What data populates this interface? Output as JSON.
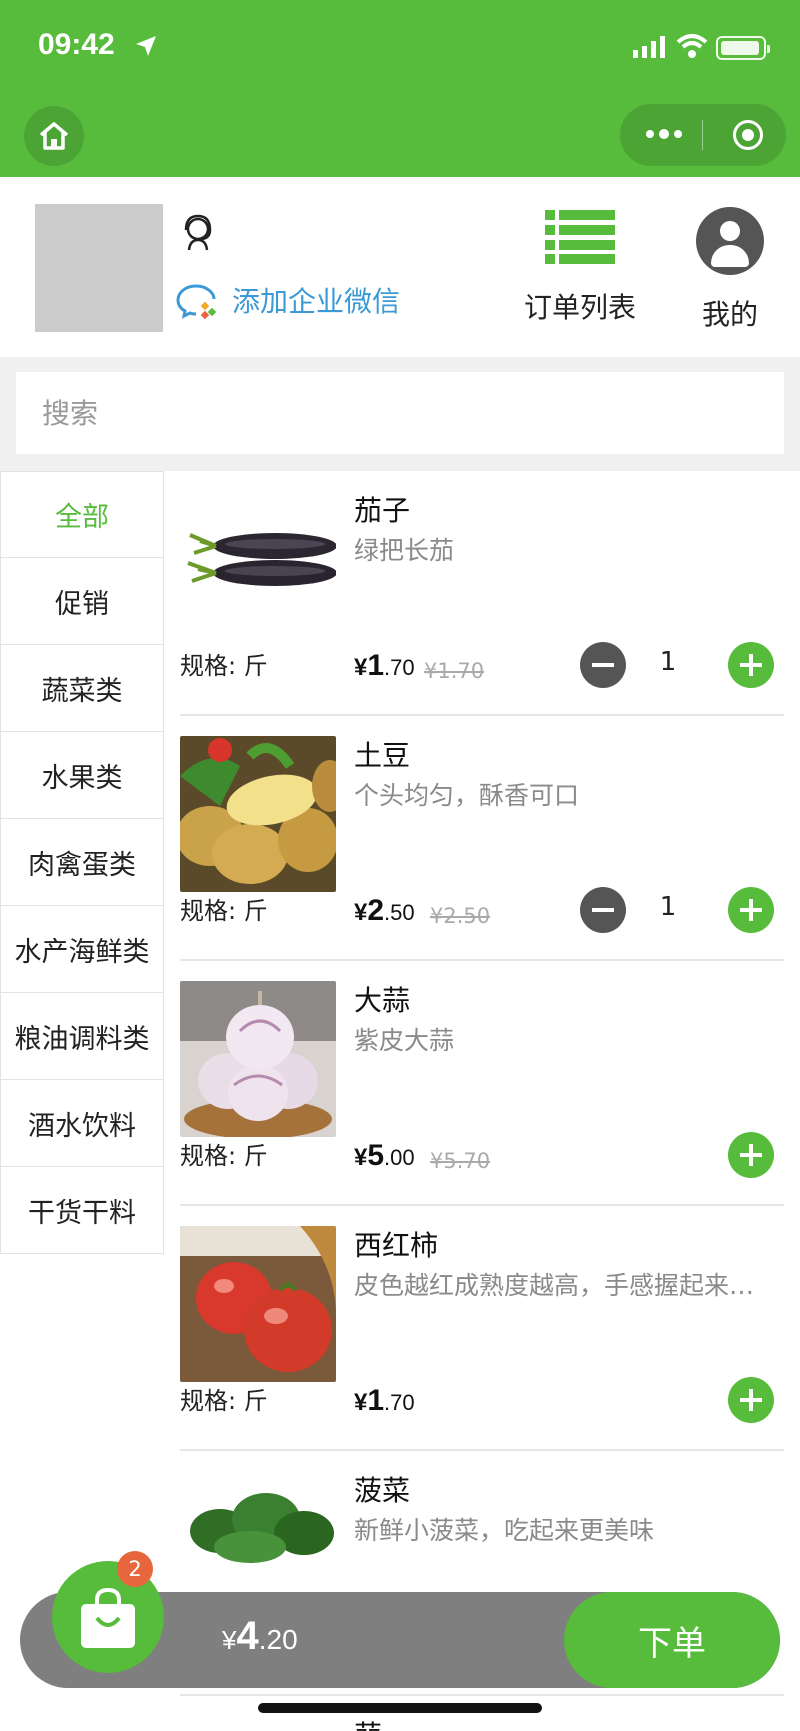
{
  "status_bar": {
    "time": "09:42"
  },
  "header": {
    "add_wechat_label": "添加企业微信",
    "orders_label": "订单列表",
    "mine_label": "我的"
  },
  "search": {
    "placeholder": "搜索"
  },
  "categories": [
    "全部",
    "促销",
    "蔬菜类",
    "水果类",
    "肉禽蛋类",
    "水产海鲜类",
    "粮油调料类",
    "酒水饮料",
    "干货干料"
  ],
  "products": [
    {
      "name": "茄子",
      "desc": "绿把长茄",
      "spec": "规格: 斤",
      "price_int": "1",
      "price_dec": ".70",
      "old_price": "¥1.70",
      "qty": "1"
    },
    {
      "name": "土豆",
      "desc": "个头均匀，酥香可口",
      "spec": "规格: 斤",
      "price_int": "2",
      "price_dec": ".50",
      "old_price": "¥2.50",
      "qty": "1"
    },
    {
      "name": "大蒜",
      "desc": "紫皮大蒜",
      "spec": "规格: 斤",
      "price_int": "5",
      "price_dec": ".00",
      "old_price": "¥5.70"
    },
    {
      "name": "西红柿",
      "desc": "皮色越红成熟度越高，手感握起来越硬越好",
      "spec": "规格: 斤",
      "price_int": "1",
      "price_dec": ".70"
    },
    {
      "name": "菠菜",
      "desc": "新鲜小菠菜，吃起来更美味"
    },
    {
      "name": "蒜"
    }
  ],
  "currency_symbol": "¥",
  "cart": {
    "badge": "2",
    "total_int": "4",
    "total_dec": ".20",
    "order_label": "下单"
  },
  "colors": {
    "brand_green": "#57bb3c",
    "badge_orange": "#e8663d",
    "link_blue": "#3b9ad6"
  }
}
